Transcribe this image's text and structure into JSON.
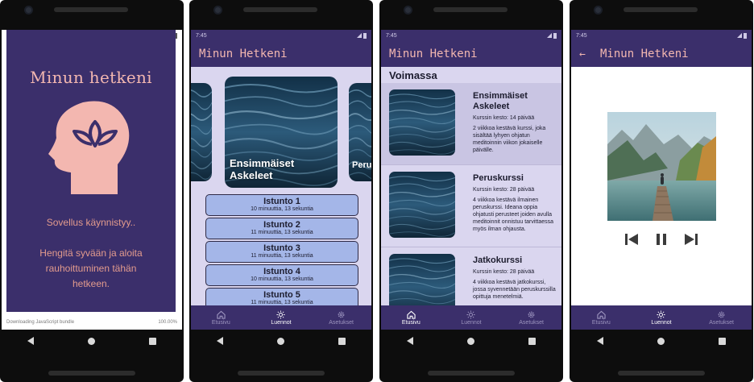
{
  "status": {
    "time": "7:45"
  },
  "splash": {
    "title": "Minun hetkeni",
    "status": "Sovellus käynnistyy..",
    "message": "Hengitä syvään ja aloita rauhoittuminen tähän hetkeen.",
    "download_text": "Downloading JavaScript bundle",
    "download_pct": "100.00%"
  },
  "app": {
    "title": "Minun Hetkeni"
  },
  "tabs": [
    {
      "label": "Etusivu",
      "icon": "home-icon"
    },
    {
      "label": "Luennot",
      "icon": "sun-icon"
    },
    {
      "label": "Asetukset",
      "icon": "gear-icon"
    }
  ],
  "carousel": {
    "main_title": "Ensimmäiset Askeleet",
    "right_peek": "Peru"
  },
  "sessions": [
    {
      "title": "Istunto 1",
      "duration": "10 minuuttia, 13 sekuntia"
    },
    {
      "title": "Istunto 2",
      "duration": "11 minuuttia, 13 sekuntia"
    },
    {
      "title": "Istunto 3",
      "duration": "11 minuuttia, 13 sekuntia"
    },
    {
      "title": "Istunto 4",
      "duration": "10 minuuttia, 13 sekuntia"
    },
    {
      "title": "Istunto 5",
      "duration": "11 minuuttia, 13 sekuntia"
    }
  ],
  "courses_section": {
    "title": "Voimassa"
  },
  "courses": [
    {
      "title": "Ensimmäiset Askeleet",
      "duration": "Kurssin kesto: 14 päivää",
      "description": "2 viikkoa kestävä kurssi, joka sisältää lyhyen ohjatun meditoinnin viikon jokaiselle päivälle."
    },
    {
      "title": "Peruskurssi",
      "duration": "Kurssin kesto: 28 päivää",
      "description": "4 viikkoa kestävä ilmainen peruskurssi. Ideana oppia ohjatusti perusteet joiden avulla meditoinnit onnistuu tarvittaessa myös ilman ohjausta."
    },
    {
      "title": "Jatkokurssi",
      "duration": "Kurssin kesto: 28 päivää",
      "description": "4 viikkoa kestävä jatkokurssi, jossa syvennetään peruskurssilla opittuja menetelmiä."
    }
  ],
  "player": {
    "controls": [
      "skip-previous-icon",
      "pause-icon",
      "skip-next-icon"
    ]
  },
  "colors": {
    "primary": "#3b2f6b",
    "accent": "#f3b7b0",
    "content_bg": "#dad6ef",
    "session_btn": "#a4b6e8"
  }
}
